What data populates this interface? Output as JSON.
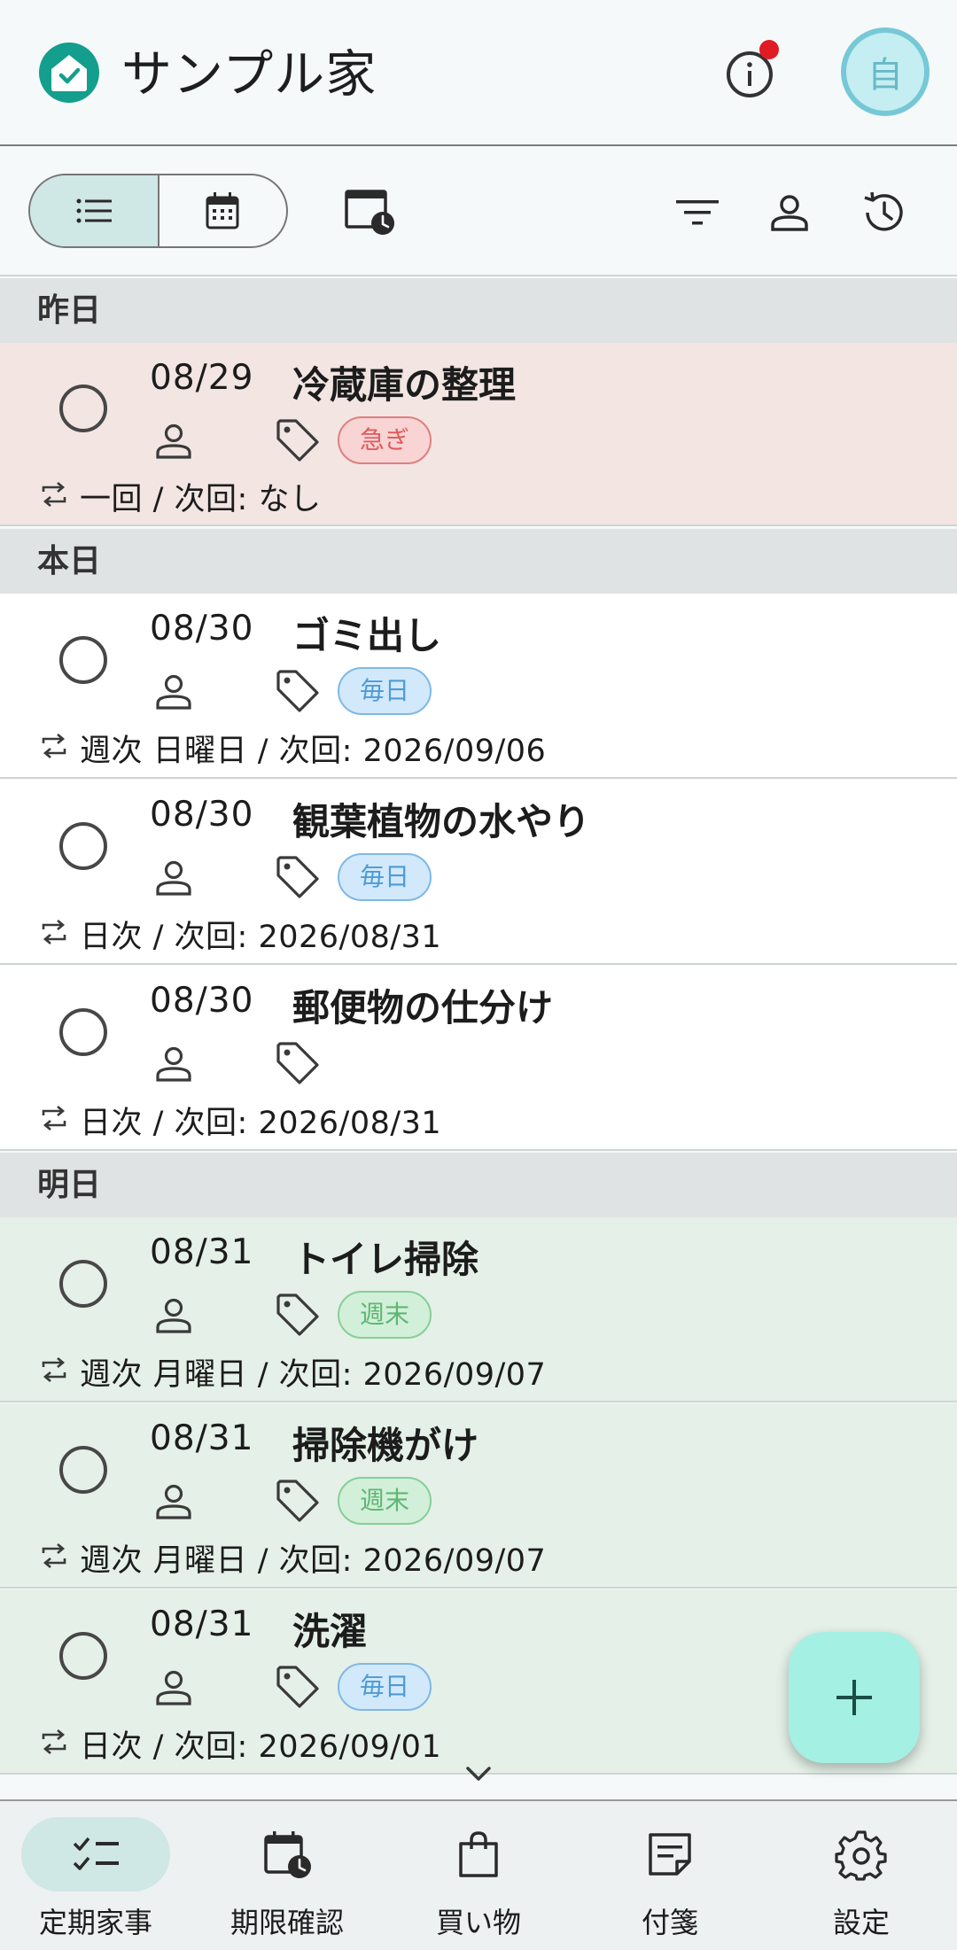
{
  "header": {
    "title": "サンプル家",
    "avatar_initial": "自"
  },
  "groups": [
    {
      "label": "昨日"
    },
    {
      "label": "本日"
    },
    {
      "label": "明日"
    }
  ],
  "tasks": [
    {
      "date": "08/29",
      "title": "冷蔵庫の整理",
      "tag": "急ぎ",
      "repeat": "一回 / 次回: なし"
    },
    {
      "date": "08/30",
      "title": "ゴミ出し",
      "tag": "毎日",
      "repeat": "週次 日曜日 / 次回: 2026/09/06"
    },
    {
      "date": "08/30",
      "title": "観葉植物の水やり",
      "tag": "毎日",
      "repeat": "日次 / 次回: 2026/08/31"
    },
    {
      "date": "08/30",
      "title": "郵便物の仕分け",
      "tag": "",
      "repeat": "日次 / 次回: 2026/08/31"
    },
    {
      "date": "08/31",
      "title": "トイレ掃除",
      "tag": "週末",
      "repeat": "週次 月曜日 / 次回: 2026/09/07"
    },
    {
      "date": "08/31",
      "title": "掃除機がけ",
      "tag": "週末",
      "repeat": "週次 月曜日 / 次回: 2026/09/07"
    },
    {
      "date": "08/31",
      "title": "洗濯",
      "tag": "毎日",
      "repeat": "日次 / 次回: 2026/09/01"
    }
  ],
  "bottom_nav": [
    {
      "label": "定期家事",
      "icon": "checklist-icon",
      "active": true
    },
    {
      "label": "期限確認",
      "icon": "calendar-clock-icon",
      "active": false
    },
    {
      "label": "買い物",
      "icon": "shopping-bag-icon",
      "active": false
    },
    {
      "label": "付箋",
      "icon": "sticky-note-icon",
      "active": false
    },
    {
      "label": "設定",
      "icon": "gear-icon",
      "active": false
    }
  ],
  "colors": {
    "brand": "#139e8d",
    "overdue_bg": "#f2e5e2",
    "tomorrow_bg": "#e4f0e8",
    "fab": "#a4f0e2",
    "urgent_chip": "#e05a5a",
    "daily_chip": "#4d9ad6",
    "weekend_chip": "#5db772"
  }
}
